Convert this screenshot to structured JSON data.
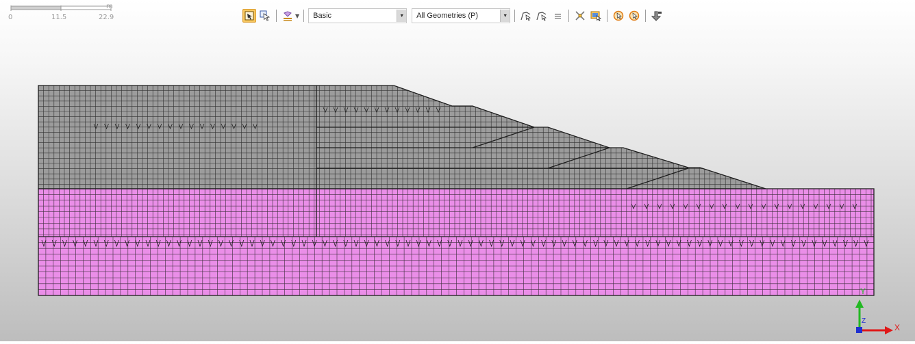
{
  "scale_bar": {
    "unit": "m",
    "ticks": [
      "0",
      "11.5",
      "22.9"
    ]
  },
  "toolbar": {
    "style_select": "Basic",
    "geometry_select": "All Geometries (P)"
  },
  "axes": {
    "x_label": "X",
    "y_label": "Y",
    "z_label": "Z"
  },
  "colors": {
    "upper_soil": "#9c9c9c",
    "lower_soil": "#ea8ee8",
    "mesh_line": "#1e1e1e",
    "x_axis": "#e01818",
    "y_axis": "#22b822",
    "z_axis": "#2030d0",
    "active_button": "#f8c860"
  },
  "icons": [
    "select-mesh-icon",
    "select-arrow-icon",
    "display-icon",
    "curve-pick-icon",
    "curve-pick-alt-icon",
    "align-icon",
    "tools-icon",
    "window-select-icon",
    "pointer-circle-icon",
    "pointer-circle-alt-icon",
    "export-icon"
  ]
}
